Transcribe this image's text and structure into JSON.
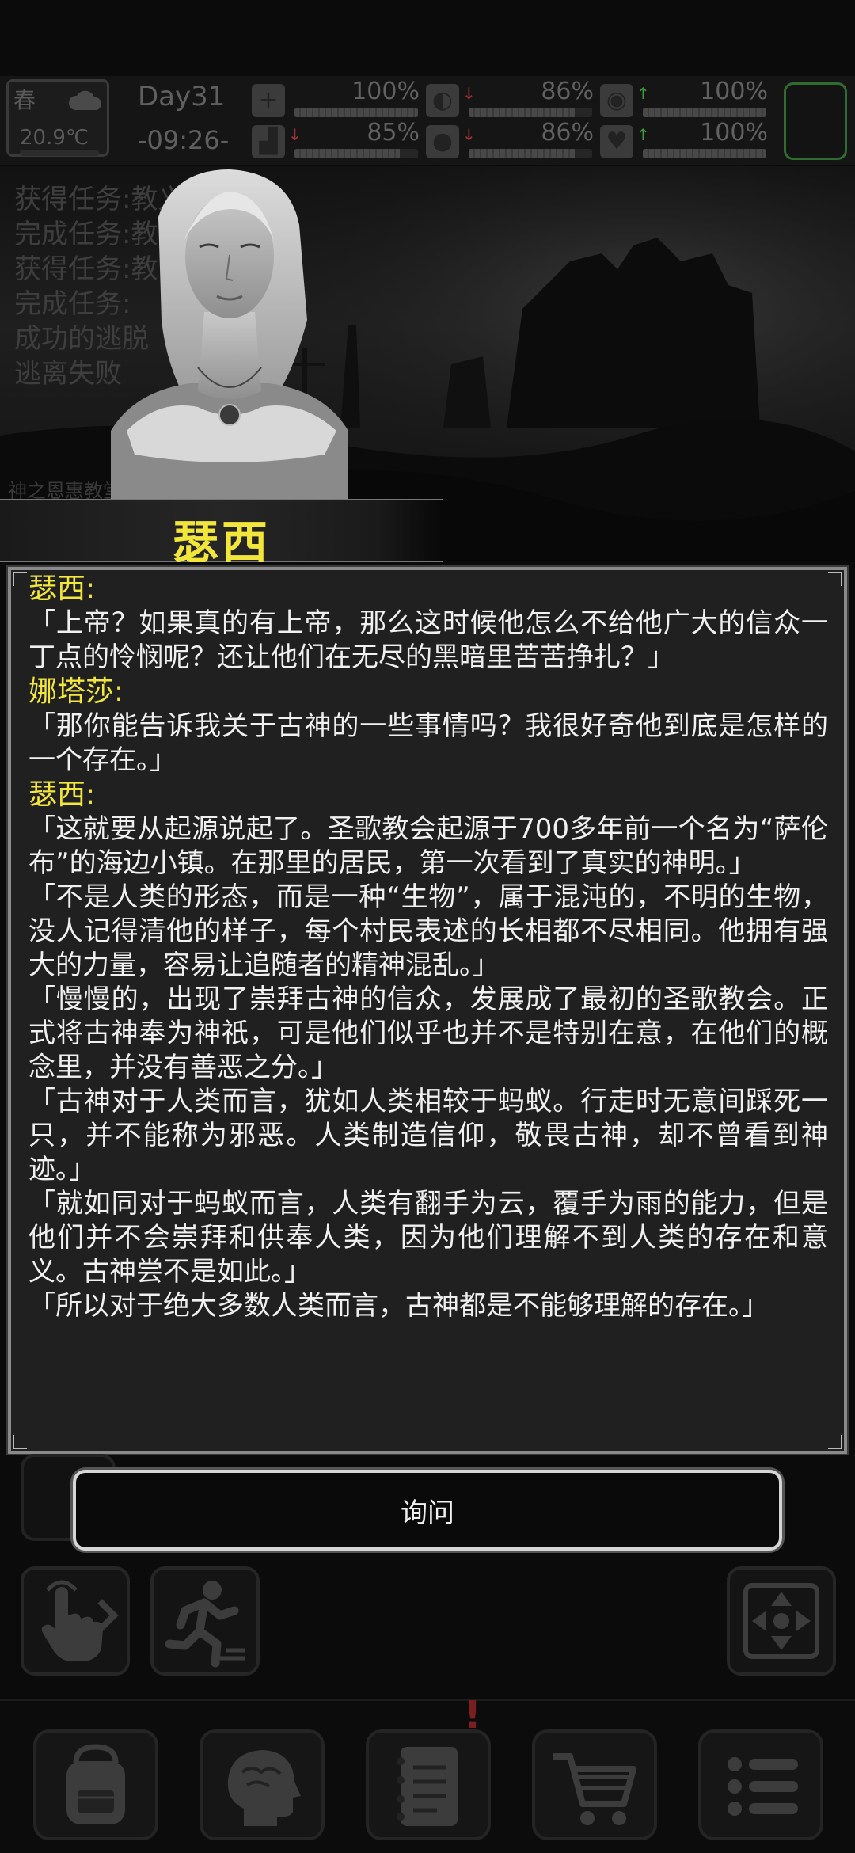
{
  "status": {
    "season": "春",
    "temperature": "20.9℃",
    "day": "Day31",
    "time": "-09:26-",
    "stats": [
      {
        "id": "health",
        "icon": "first-aid-icon",
        "value": "100%",
        "level": 1.0,
        "trend": ""
      },
      {
        "id": "hunger",
        "icon": "stomach-icon",
        "value": "86%",
        "level": 0.86,
        "trend": "down"
      },
      {
        "id": "mood",
        "icon": "face-mask-icon",
        "value": "100%",
        "level": 1.0,
        "trend": "up"
      },
      {
        "id": "stamina",
        "icon": "boot-icon",
        "value": "85%",
        "level": 0.85,
        "trend": "down"
      },
      {
        "id": "thirst",
        "icon": "water-drop-icon",
        "value": "86%",
        "level": 0.86,
        "trend": "down"
      },
      {
        "id": "spirit",
        "icon": "heart-icon",
        "value": "100%",
        "level": 1.0,
        "trend": "up"
      }
    ]
  },
  "log": {
    "lines": [
      "获得任务:教义",
      "完成任务:教",
      "获得任务:教",
      "完成任务:",
      "成功的逃脱",
      "逃离失败"
    ],
    "caption": "神之恩惠教堂·1楼"
  },
  "npc": {
    "name": "瑟西"
  },
  "dialog": {
    "entries": [
      {
        "speaker": "瑟西:",
        "lines": [
          "「上帝？如果真的有上帝，那么这时候他怎么不给他广大的信众一丁点的怜悯呢？还让他们在无尽的黑暗里苦苦挣扎？」"
        ]
      },
      {
        "speaker": "娜塔莎:",
        "lines": [
          "「那你能告诉我关于古神的一些事情吗？我很好奇他到底是怎样的一个存在。」"
        ]
      },
      {
        "speaker": "瑟西:",
        "lines": [
          "「这就要从起源说起了。圣歌教会起源于700多年前一个名为“萨伦布”的海边小镇。在那里的居民，第一次看到了真实的神明。」",
          "「不是人类的形态，而是一种“生物”，属于混沌的，不明的生物，没人记得清他的样子，每个村民表述的长相都不尽相同。他拥有强大的力量，容易让追随者的精神混乱。」",
          "「慢慢的，出现了崇拜古神的信众，发展成了最初的圣歌教会。正式将古神奉为神祇，可是他们似乎也并不是特别在意，在他们的概念里，并没有善恶之分。」",
          "「古神对于人类而言，犹如人类相较于蚂蚁。行走时无意间踩死一只，并不能称为邪恶。人类制造信仰，敬畏古神，却不曾看到神迹。」",
          "「就如同对于蚂蚁而言，人类有翻手为云，覆手为雨的能力，但是他们并不会崇拜和供奉人类，因为他们理解不到人类的存在和意义。古神尝不是如此。」",
          "「所以对于绝大多数人类而言，古神都是不能够理解的存在。」"
        ]
      }
    ]
  },
  "actions": {
    "ask_label": "询问"
  },
  "controls": {
    "interact_icon": "tap-hand-icon",
    "run_icon": "running-man-icon",
    "move_icon": "directional-pad-icon"
  },
  "tabs": [
    {
      "id": "inventory",
      "icon": "backpack-icon"
    },
    {
      "id": "skills",
      "icon": "brain-icon"
    },
    {
      "id": "journal",
      "icon": "notebook-icon",
      "alert": "!"
    },
    {
      "id": "shop",
      "icon": "shopping-cart-icon"
    },
    {
      "id": "menu",
      "icon": "menu-list-icon"
    }
  ]
}
